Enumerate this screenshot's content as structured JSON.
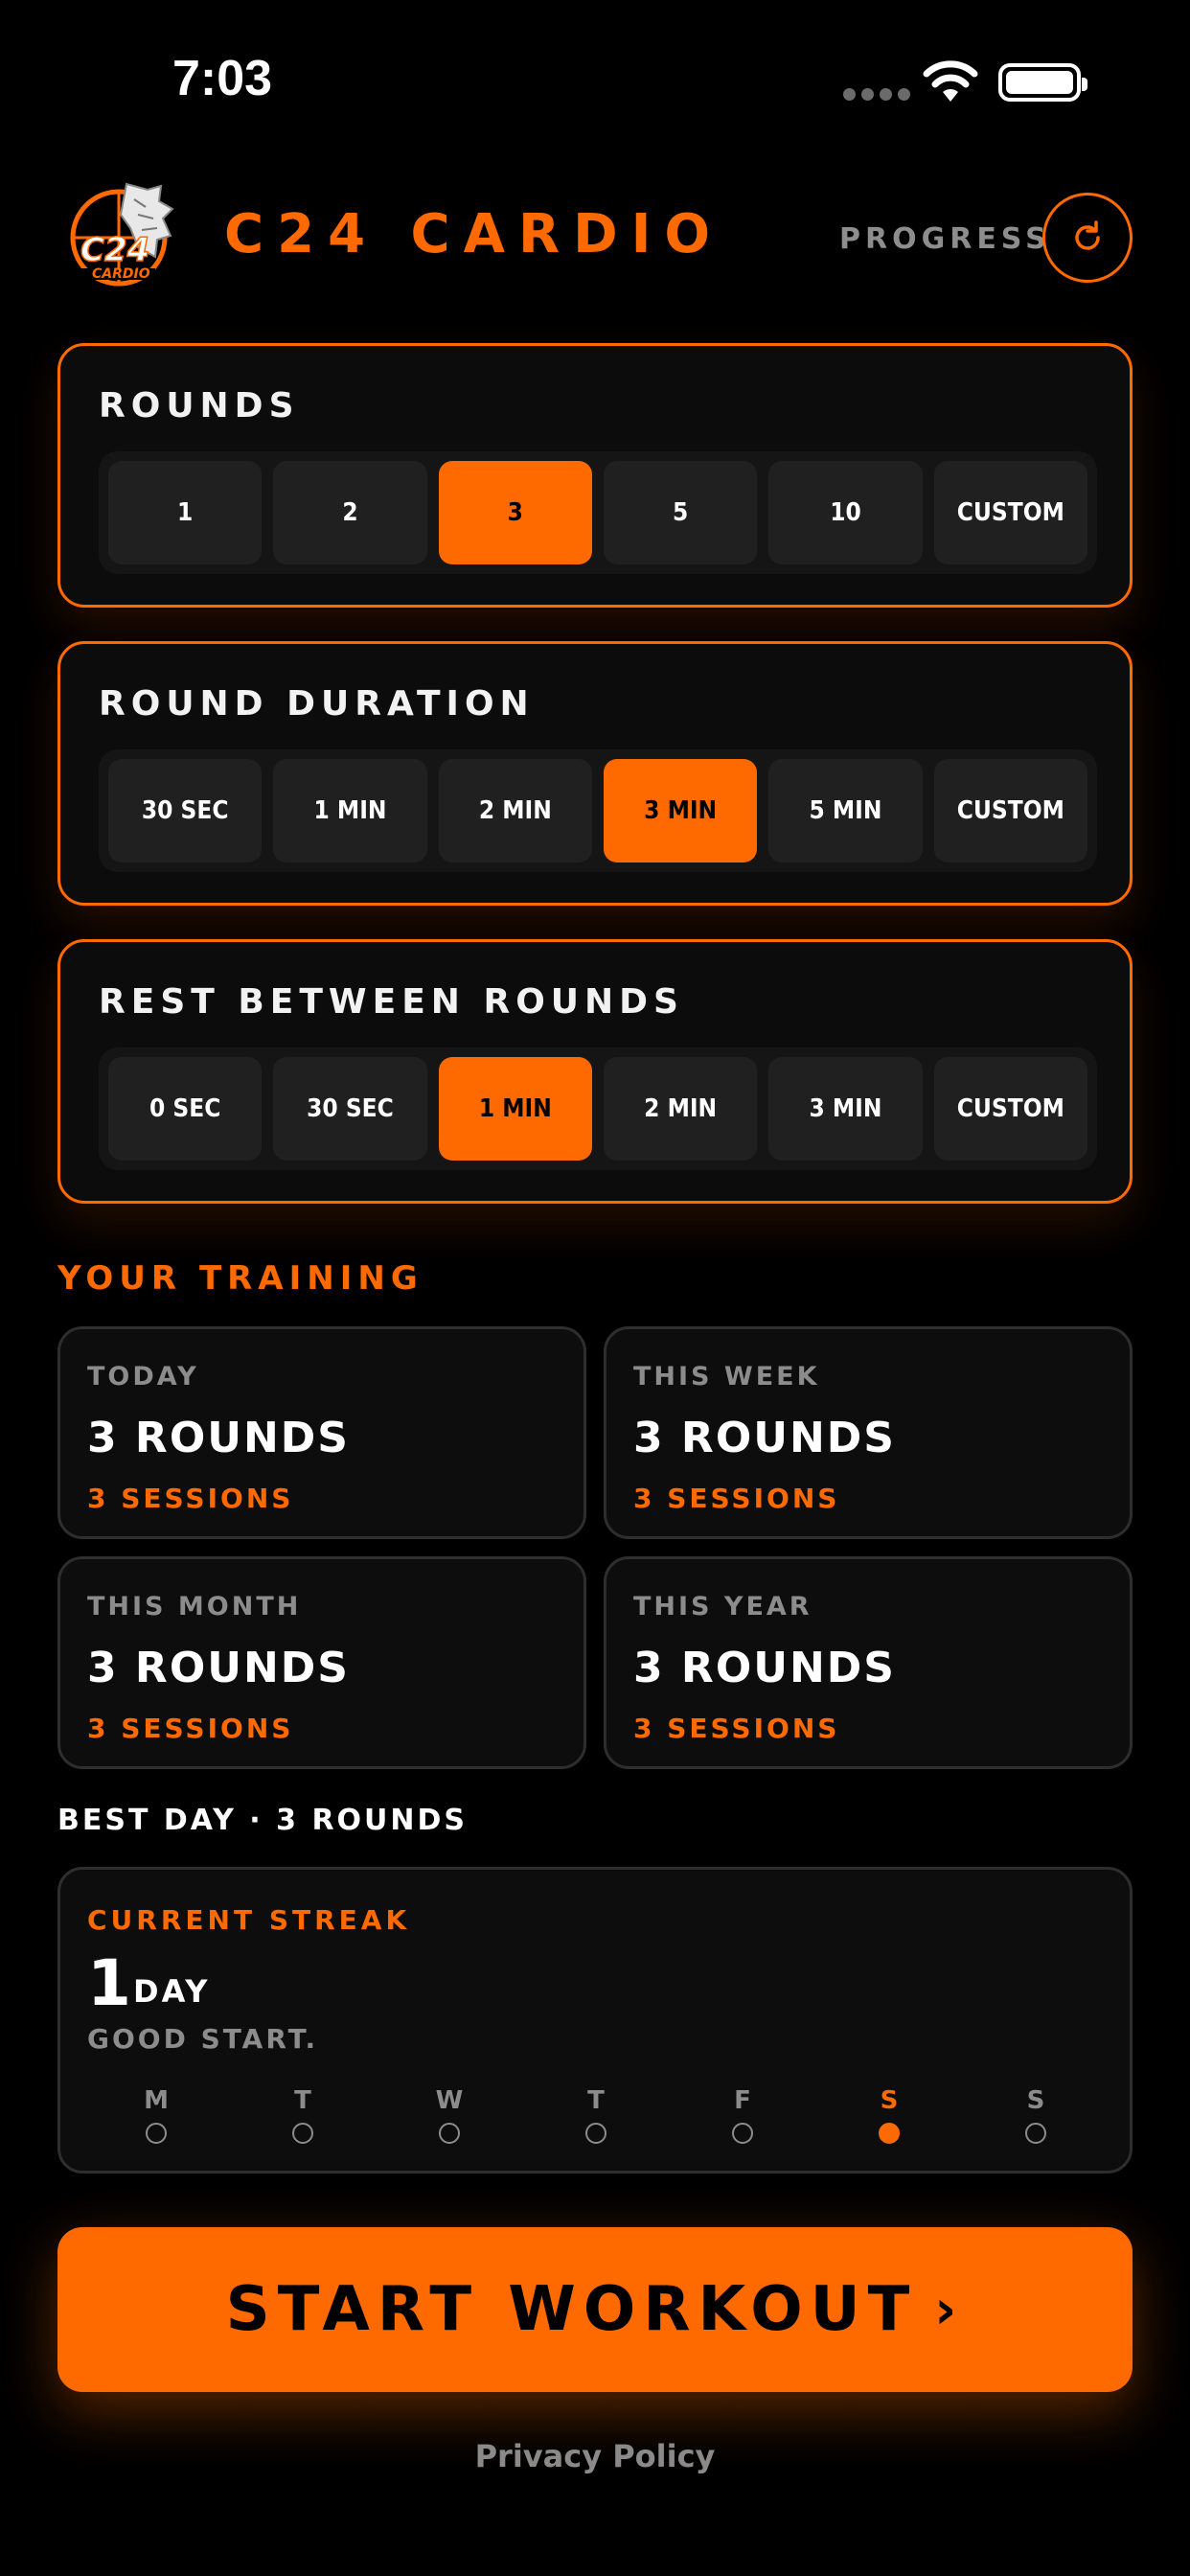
{
  "status_bar": {
    "time": "7:03"
  },
  "header": {
    "logo_text": "C24",
    "logo_sub": "CARDIO",
    "brand": "C24 CARDIO",
    "progress_label": "PROGRESS"
  },
  "settings": [
    {
      "title": "ROUNDS",
      "options": [
        "1",
        "2",
        "3",
        "5",
        "10",
        "CUSTOM"
      ],
      "selected": "3"
    },
    {
      "title": "ROUND DURATION",
      "options": [
        "30 SEC",
        "1 MIN",
        "2 MIN",
        "3 MIN",
        "5 MIN",
        "CUSTOM"
      ],
      "selected": "3 MIN"
    },
    {
      "title": "REST BETWEEN ROUNDS",
      "options": [
        "0 SEC",
        "30 SEC",
        "1 MIN",
        "2 MIN",
        "3 MIN",
        "CUSTOM"
      ],
      "selected": "1 MIN"
    }
  ],
  "training": {
    "title": "YOUR TRAINING",
    "stats": [
      {
        "label": "TODAY",
        "value": "3 ROUNDS",
        "sub": "3 SESSIONS"
      },
      {
        "label": "THIS WEEK",
        "value": "3 ROUNDS",
        "sub": "3 SESSIONS"
      },
      {
        "label": "THIS MONTH",
        "value": "3 ROUNDS",
        "sub": "3 SESSIONS"
      },
      {
        "label": "THIS YEAR",
        "value": "3 ROUNDS",
        "sub": "3 SESSIONS"
      }
    ],
    "best_day": "BEST DAY · 3 ROUNDS"
  },
  "streak": {
    "label": "CURRENT STREAK",
    "count": "1",
    "unit": "DAY",
    "message": "GOOD START.",
    "days": [
      "M",
      "T",
      "W",
      "T",
      "F",
      "S",
      "S"
    ],
    "active_index": 5
  },
  "start_button": {
    "label": "START WORKOUT",
    "chevron": "›"
  },
  "footer": {
    "privacy": "Privacy Policy"
  },
  "colors": {
    "accent": "#ff6a00",
    "background": "#000000",
    "muted": "#8c8c8c"
  }
}
